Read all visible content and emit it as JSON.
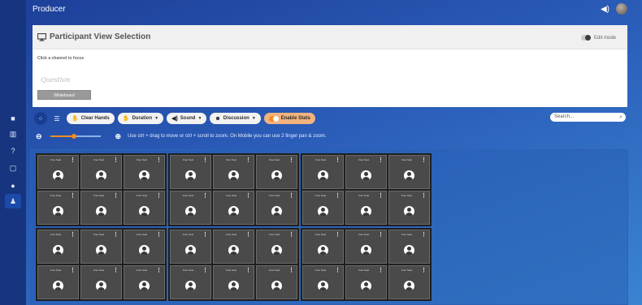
{
  "app": {
    "title": "Producer"
  },
  "header": {
    "speaker_icon": "volume-icon",
    "avatar": "user-avatar"
  },
  "sidebar": {
    "items": [
      {
        "icon": "video-icon",
        "glyph": "■"
      },
      {
        "icon": "chart-icon",
        "glyph": "▥"
      },
      {
        "icon": "help-icon",
        "glyph": "?"
      },
      {
        "icon": "screen-icon",
        "glyph": "▢"
      },
      {
        "icon": "chat-icon",
        "glyph": "●"
      },
      {
        "icon": "participants-icon",
        "glyph": "♟"
      }
    ],
    "active_index": 5
  },
  "panel": {
    "title": "Participant View Selection",
    "edit_mode_label": "Edit mode",
    "hint": "Click a channel to focus",
    "whiteboard_scribble": "Question",
    "whiteboard_button": "Whiteboard"
  },
  "toolbar": {
    "clear_hands": "Clear Hands",
    "duration": "Duration",
    "sound": "Sound",
    "discussion": "Discussion",
    "enable_stats": "Enable Stats",
    "search_placeholder": "Search..."
  },
  "zoom": {
    "level": 0.47,
    "hint": "Use ctrl + drag to move or ctrl + scroll to zoom. On Mobile you can use 2 finger pan & zoom."
  },
  "grid": {
    "groups": 6,
    "tiles_per_group": 6,
    "tile_label": "Free Seat"
  },
  "colors": {
    "accent": "#f58c1f",
    "rail": "#17357f",
    "tile": "#4a4a4a"
  }
}
